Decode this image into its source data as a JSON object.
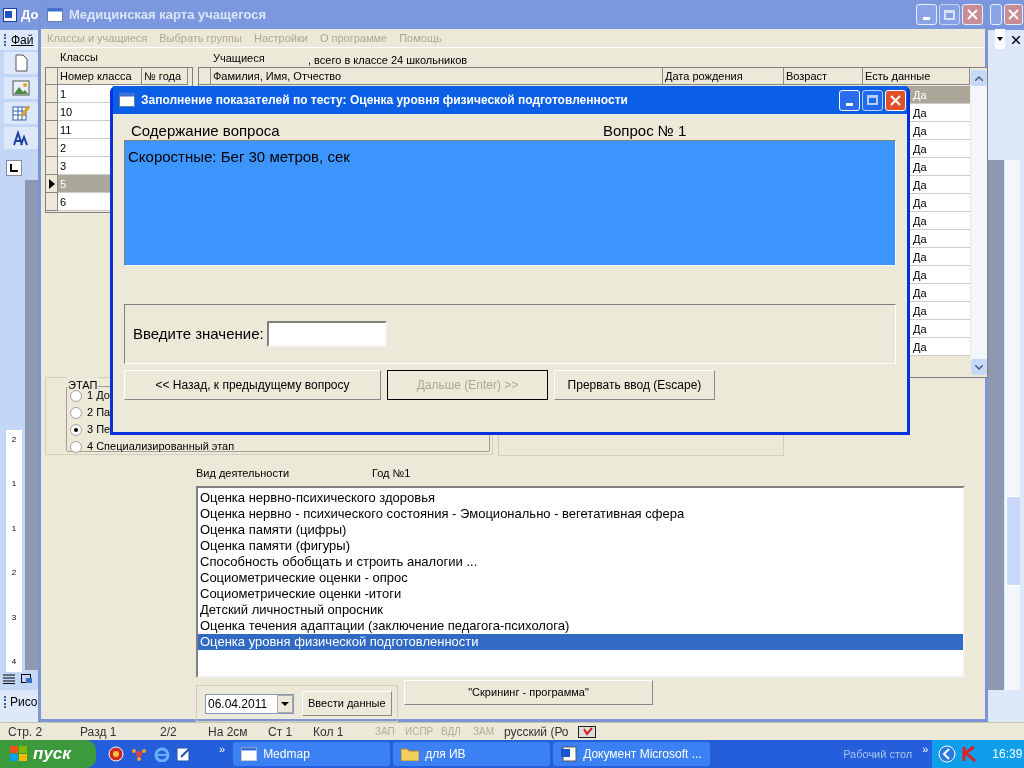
{
  "word": {
    "title": "До",
    "menu": "Фай",
    "ruler": [
      "2",
      "1",
      "1",
      "2",
      "3",
      "4"
    ],
    "draw_toolbar": "Рисо",
    "status": [
      {
        "text": "Стр. 2",
        "disabled": false
      },
      {
        "text": "Разд 1",
        "disabled": false
      },
      {
        "text": "2/2",
        "disabled": false
      },
      {
        "text": "На 2см",
        "disabled": false
      },
      {
        "text": "Ст 1",
        "disabled": false
      },
      {
        "text": "Кол 1",
        "disabled": false
      },
      {
        "text": "ЗАП",
        "disabled": true
      },
      {
        "text": "ИСПР",
        "disabled": true
      },
      {
        "text": "ВДЛ",
        "disabled": true
      },
      {
        "text": "ЗАМ",
        "disabled": true
      },
      {
        "text": "русский (Ро",
        "disabled": false
      }
    ]
  },
  "main": {
    "title": "Медицинская карта учащегося",
    "active": false,
    "menu": [
      {
        "label": "Классы и учащиеся",
        "disabled": true
      },
      {
        "label": "Выбрать группы",
        "disabled": true
      },
      {
        "label": "Настройки",
        "disabled": true
      },
      {
        "label": "О программе",
        "disabled": true
      },
      {
        "label": "Помощь",
        "disabled": true
      }
    ],
    "classes_label": "Классы",
    "students_label": "Учащиеся",
    "students_count": ", всего в классе 24 школьников",
    "classes_table": {
      "columns": [
        "Номер класса",
        "№ года"
      ],
      "rows": [
        {
          "number": "1",
          "selected": false
        },
        {
          "number": "10",
          "selected": false
        },
        {
          "number": "11",
          "selected": false
        },
        {
          "number": "2",
          "selected": false
        },
        {
          "number": "3",
          "selected": false
        },
        {
          "number": "5",
          "selected": true
        },
        {
          "number": "6",
          "selected": false
        }
      ]
    },
    "students_table": {
      "columns": [
        "Фамилия, Имя, Отчество",
        "Дата рождения",
        "Возраст",
        "Есть данные"
      ],
      "rows": [
        {
          "has_data": "Да",
          "selected": true
        },
        {
          "has_data": "Да",
          "selected": false
        },
        {
          "has_data": "Да",
          "selected": false
        },
        {
          "has_data": "Да",
          "selected": false
        },
        {
          "has_data": "Да",
          "selected": false
        },
        {
          "has_data": "Да",
          "selected": false
        },
        {
          "has_data": "Да",
          "selected": false
        },
        {
          "has_data": "Да",
          "selected": false
        },
        {
          "has_data": "Да",
          "selected": false
        },
        {
          "has_data": "Да",
          "selected": false
        },
        {
          "has_data": "Да",
          "selected": false
        },
        {
          "has_data": "Да",
          "selected": false
        },
        {
          "has_data": "Да",
          "selected": false
        },
        {
          "has_data": "Да",
          "selected": false
        },
        {
          "has_data": "Да",
          "selected": false
        }
      ]
    },
    "stage": {
      "title": "ЭТАП",
      "options": [
        {
          "label": "1 До",
          "selected": false
        },
        {
          "label": "2 Па",
          "selected": false
        },
        {
          "label": "3 Пе",
          "selected": true
        },
        {
          "label": "4 Специализированный этап",
          "selected": false
        }
      ]
    },
    "activity_label": "Вид деятельности",
    "year_label": "Год №1",
    "activities": [
      {
        "label": "Оценка нервно-психического здоровья",
        "selected": false
      },
      {
        "label": "Оценка нервно - психического состояния - Эмоционально - вегетативная сфера",
        "selected": false
      },
      {
        "label": "Оценка памяти (цифры)",
        "selected": false
      },
      {
        "label": "Оценка памяти (фигуры)",
        "selected": false
      },
      {
        "label": "Способность обобщать и строить аналогии ...",
        "selected": false
      },
      {
        "label": "Социометрические оценки - опрос",
        "selected": false
      },
      {
        "label": "Социометрические оценки -итоги",
        "selected": false
      },
      {
        "label": "Детский личностный опросник",
        "selected": false
      },
      {
        "label": "Оценка течения адаптации (заключение педагога-психолога)",
        "selected": false
      },
      {
        "label": "Оценка уровня физической подготовленности",
        "selected": true
      }
    ],
    "date": "06.04.2011",
    "enter_button": "Ввести данные",
    "screening_button": "\"Скрининг - программа\""
  },
  "dialog": {
    "title": "Заполнение показателей по тесту: Оценка уровня физической подготовленности",
    "active": true,
    "content_label": "Содержание вопроса",
    "question_number": "Вопрос № 1",
    "question": "Скоростные: Бег 30 метров, сек",
    "value_label": "Введите значение:",
    "buttons": [
      {
        "label": "<< Назад, к предыдущему вопросу",
        "disabled": false
      },
      {
        "label": "Дальше (Enter) >>",
        "disabled": true
      },
      {
        "label": "Прервать ввод (Escape)",
        "disabled": false
      }
    ]
  },
  "taskbar": {
    "start": "пуск",
    "more": "»",
    "tasks": [
      {
        "label": "Medmap",
        "kind": "window"
      },
      {
        "label": "для ИВ",
        "kind": "folder"
      },
      {
        "label": "Документ Microsoft ...",
        "kind": "document"
      }
    ],
    "desktop": "Рабочий стол",
    "tray_more": "»",
    "clock": "16:39"
  }
}
